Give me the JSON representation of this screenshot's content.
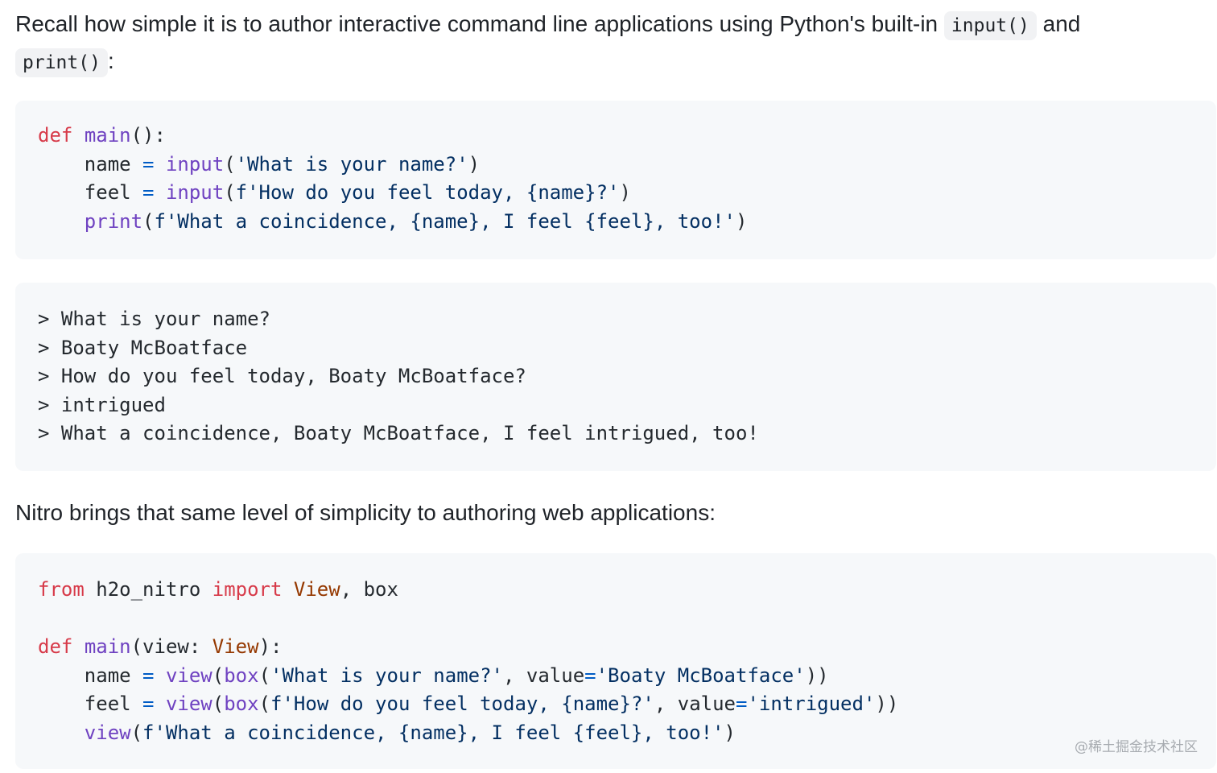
{
  "intro": {
    "before": "Recall how simple it is to author interactive command line applications using Python's built-in",
    "code1": "input()",
    "middle": "and",
    "code2": "print()",
    "after": ":"
  },
  "code_block_1": {
    "line1": {
      "kw": "def",
      "fn": "main",
      "rest": "():"
    },
    "line2": {
      "var": "name",
      "op": "=",
      "fn": "input",
      "open": "(",
      "str": "'What is your name?'",
      "close": ")"
    },
    "line3": {
      "var": "feel",
      "op": "=",
      "fn": "input",
      "open": "(",
      "str": "f'How do you feel today, {name}?'",
      "close": ")"
    },
    "line4": {
      "fn": "print",
      "open": "(",
      "str": "f'What a coincidence, {name}, I feel {feel}, too!'",
      "close": ")"
    }
  },
  "terminal_output": {
    "lines": [
      "> What is your name?",
      "> Boaty McBoatface",
      "> How do you feel today, Boaty McBoatface?",
      "> intrigued",
      "> What a coincidence, Boaty McBoatface, I feel intrigued, too!"
    ]
  },
  "outro": {
    "text": "Nitro brings that same level of simplicity to authoring web applications:"
  },
  "code_block_2": {
    "line1": {
      "kw1": "from",
      "mod": "h2o_nitro",
      "kw2": "import",
      "cls": "View",
      "rest": ", box"
    },
    "line3": {
      "kw": "def",
      "fn": "main",
      "open": "(view: ",
      "cls": "View",
      "close": "):"
    },
    "line4": {
      "var": "name",
      "op": "=",
      "fn1": "view",
      "fn2": "box",
      "str1": "'What is your name?'",
      "arg": "value",
      "str2": "'Boaty McBoatface'",
      "close": "))"
    },
    "line5": {
      "var": "feel",
      "op": "=",
      "fn1": "view",
      "fn2": "box",
      "str1": "f'How do you feel today, {name}?'",
      "arg": "value",
      "str2": "'intrigued'",
      "close": "))"
    },
    "line6": {
      "fn": "view",
      "str": "f'What a coincidence, {name}, I feel {feel}, too!'",
      "close": ")"
    }
  },
  "watermark": "@稀土掘金技术社区"
}
